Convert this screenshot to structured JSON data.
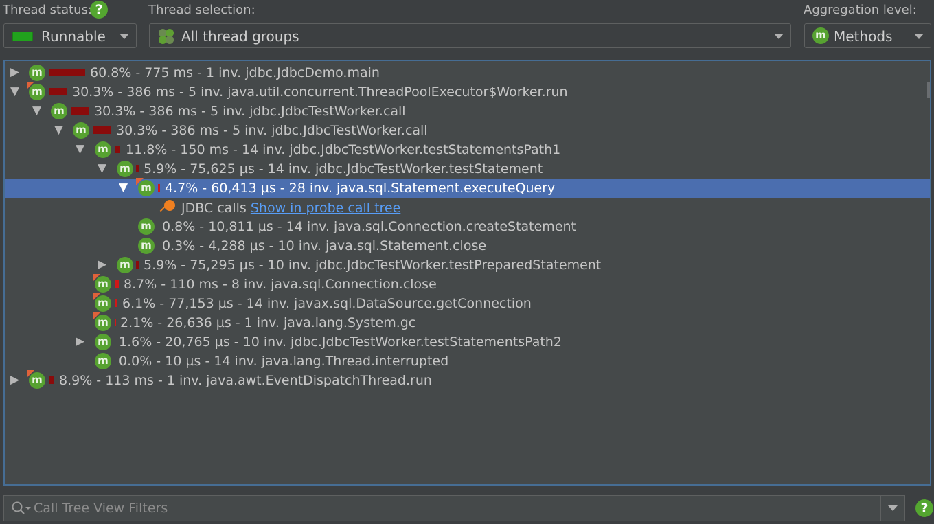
{
  "toolbar": {
    "thread_status_label": "Thread status:",
    "thread_status_value": "Runnable",
    "thread_status_color": "#21a21d",
    "thread_selection_label": "Thread selection:",
    "thread_selection_value": "All thread groups",
    "aggregation_label": "Aggregation level:",
    "aggregation_value": "Methods",
    "help_glyph": "?"
  },
  "tree": {
    "icon_letter": "m",
    "rows": [
      {
        "text": "60.8% - 775 ms - 1 inv. jdbc.JdbcDemo.main",
        "toggle": "▶"
      },
      {
        "text": "30.3% - 386 ms - 5 inv. java.util.concurrent.ThreadPoolExecutor$Worker.run",
        "toggle": "▼"
      },
      {
        "text": "30.3% - 386 ms - 5 inv. jdbc.JdbcTestWorker.call",
        "toggle": "▼"
      },
      {
        "text": "30.3% - 386 ms - 5 inv. jdbc.JdbcTestWorker.call",
        "toggle": "▼"
      },
      {
        "text": "11.8% - 150 ms - 14 inv. jdbc.JdbcTestWorker.testStatementsPath1",
        "toggle": "▼"
      },
      {
        "text": "5.9% - 75,625 µs - 14 inv. jdbc.JdbcTestWorker.testStatement",
        "toggle": "▼"
      },
      {
        "text": "4.7% - 60,413 µs - 28 inv. java.sql.Statement.executeQuery",
        "toggle": "▼"
      },
      {
        "text": "JDBC calls",
        "link": "Show in probe call tree"
      },
      {
        "text": "0.8% - 10,811 µs - 14 inv. java.sql.Connection.createStatement"
      },
      {
        "text": "0.3% - 4,288 µs - 10 inv. java.sql.Statement.close"
      },
      {
        "text": "5.9% - 75,295 µs - 10 inv. jdbc.JdbcTestWorker.testPreparedStatement",
        "toggle": "▶"
      },
      {
        "text": "8.7% - 110 ms - 8 inv. java.sql.Connection.close"
      },
      {
        "text": "6.1% - 77,153 µs - 14 inv. javax.sql.DataSource.getConnection"
      },
      {
        "text": "2.1% - 26,636 µs - 1 inv. java.lang.System.gc"
      },
      {
        "text": "1.6% - 20,765 µs - 10 inv. jdbc.JdbcTestWorker.testStatementsPath2",
        "toggle": "▶"
      },
      {
        "text": "0.0% - 10 µs - 14 inv. java.lang.Thread.interrupted"
      },
      {
        "text": "8.9% - 113 ms - 1 inv. java.awt.EventDispatchThread.run",
        "toggle": "▶"
      }
    ]
  },
  "filter": {
    "placeholder": "Call Tree View Filters"
  }
}
